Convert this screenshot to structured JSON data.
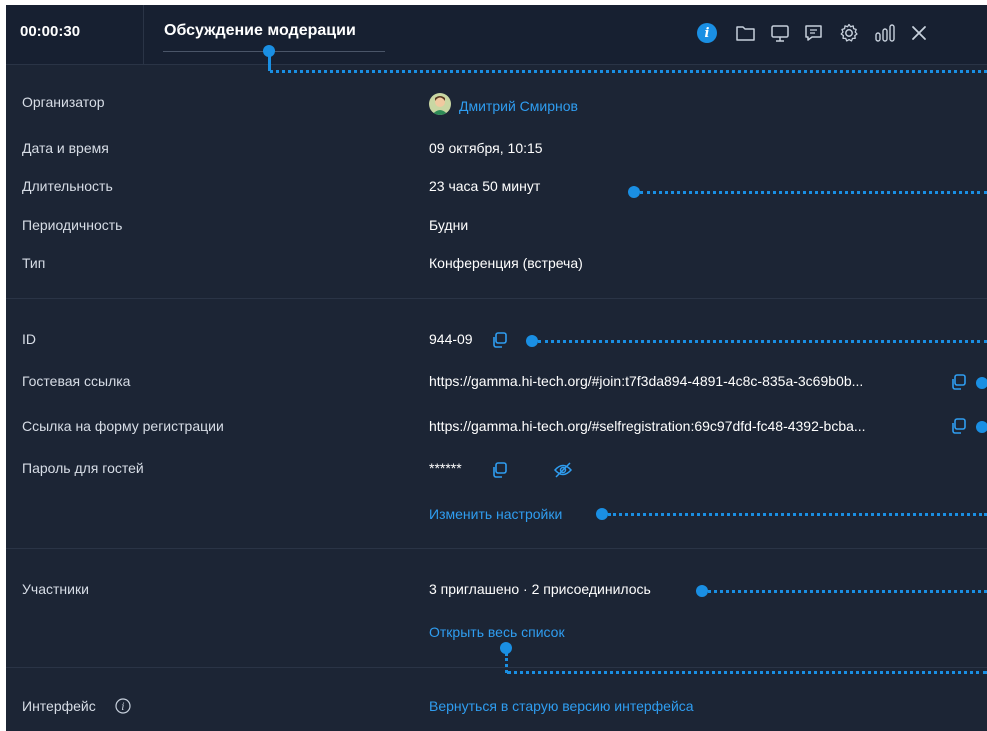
{
  "header": {
    "timer": "00:00:30",
    "title": "Обсуждение модерации",
    "icons": [
      "info-icon",
      "folder-icon",
      "screen-share-icon",
      "chat-icon",
      "settings-icon",
      "stats-icon",
      "close-icon"
    ]
  },
  "details": {
    "organizer_label": "Организатор",
    "organizer_name": "Дмитрий Смирнов",
    "datetime_label": "Дата и время",
    "datetime_value": "09 октября, 10:15",
    "duration_label": "Длительность",
    "duration_value": "23 часа 50 минут",
    "periodicity_label": "Периодичность",
    "periodicity_value": "Будни",
    "type_label": "Тип",
    "type_value": "Конференция (встреча)"
  },
  "access": {
    "id_label": "ID",
    "id_value": "944-09",
    "guest_link_label": "Гостевая ссылка",
    "guest_link_value": "https://gamma.hi-tech.org/#join:t7f3da894-4891-4c8c-835a-3c69b0b...",
    "reg_link_label": "Ссылка на форму регистрации",
    "reg_link_value": "https://gamma.hi-tech.org/#selfregistration:69c97dfd-fc48-4392-bcba...",
    "guest_password_label": "Пароль для гостей",
    "guest_password_value": "******",
    "change_settings_link": "Изменить настройки"
  },
  "participants": {
    "label": "Участники",
    "summary": "3 приглашено · 2 присоединилось",
    "open_list_link": "Открыть весь список"
  },
  "interface": {
    "label": "Интерфейс",
    "old_version_link": "Вернуться в старую версию интерфейса"
  },
  "colors": {
    "background": "#1c2535",
    "header": "#172031",
    "accent": "#1a8fe3",
    "link": "#2f9df0"
  }
}
